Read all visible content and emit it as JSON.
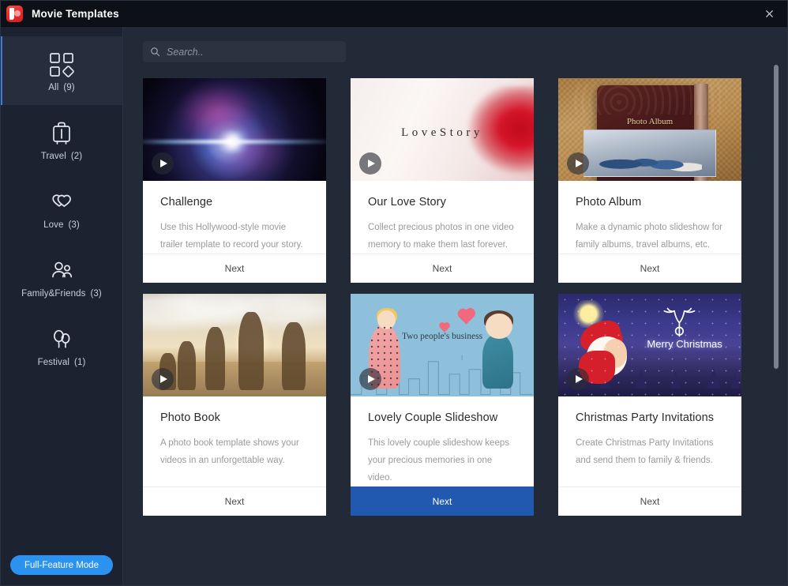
{
  "window": {
    "title": "Movie Templates",
    "logo_icon": "app-logo-icon",
    "close_icon": "close-icon"
  },
  "sidebar": {
    "items": [
      {
        "id": "all",
        "label": "All",
        "count": "(9)",
        "icon": "grid-icon",
        "active": true
      },
      {
        "id": "travel",
        "label": "Travel",
        "count": "(2)",
        "icon": "suitcase-icon",
        "active": false
      },
      {
        "id": "love",
        "label": "Love",
        "count": "(3)",
        "icon": "hearts-icon",
        "active": false
      },
      {
        "id": "family-friends",
        "label": "Family&Friends",
        "count": "(3)",
        "icon": "people-icon",
        "active": false
      },
      {
        "id": "festival",
        "label": "Festival",
        "count": "(1)",
        "icon": "balloons-icon",
        "active": false
      }
    ],
    "full_feature_label": "Full-Feature Mode"
  },
  "search": {
    "placeholder": "Search..",
    "value": "",
    "icon": "search-icon"
  },
  "colors": {
    "accent_blue": "#2159b0",
    "full_feature_blue": "#2b93ef",
    "window_bg": "#1e2430",
    "sidebar_bg": "#1c2230",
    "content_bg": "#232a37",
    "card_bg": "#ffffff",
    "logo_red": "#e8262b"
  },
  "templates": [
    {
      "id": "challenge",
      "title": "Challenge",
      "description": "Use this Hollywood-style movie trailer template to record your story.",
      "next_label": "Next",
      "thumb": "space-nebula",
      "selected": false
    },
    {
      "id": "our-love-story",
      "title": "Our Love Story",
      "description": "Collect precious photos in one video memory to make them last forever.",
      "next_label": "Next",
      "thumb": "rose-petals",
      "thumb_text": "LoveStory",
      "selected": false
    },
    {
      "id": "photo-album",
      "title": "Photo Album",
      "description": "Make a dynamic photo slideshow for family albums, travel albums, etc.",
      "next_label": "Next",
      "thumb": "leather-photo-album",
      "thumb_text": "Photo Album",
      "selected": false
    },
    {
      "id": "photo-book",
      "title": "Photo Book",
      "description": "A photo book template shows your videos in an unforgettable way.",
      "next_label": "Next",
      "thumb": "beach-runners",
      "selected": false
    },
    {
      "id": "lovely-couple-slideshow",
      "title": "Lovely Couple Slideshow",
      "description": "This lovely couple slideshow keeps your precious memories in one video.",
      "next_label": "Next",
      "thumb": "cartoon-couple",
      "thumb_text": "Two people's business",
      "selected": true
    },
    {
      "id": "christmas-party-invitations",
      "title": "Christmas Party Invitations",
      "description": "Create Christmas Party Invitations and send them to family & friends.",
      "next_label": "Next",
      "thumb": "christmas-night",
      "thumb_text": "Merry Christmas",
      "selected": false
    }
  ]
}
